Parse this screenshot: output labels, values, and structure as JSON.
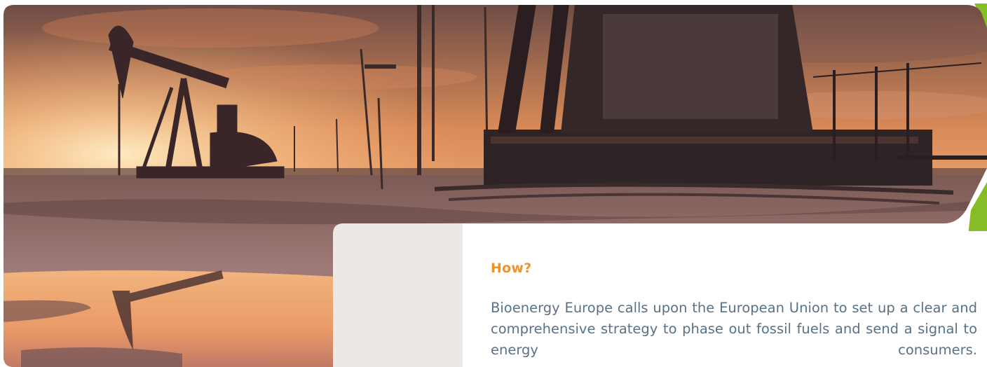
{
  "section": {
    "heading": "How?",
    "body": "Bioenergy Europe calls upon the European Union to set up a clear and comprehensive strategy to phase out fossil fuels and send a signal to energy consumers."
  },
  "colors": {
    "heading_accent": "#f0922b",
    "body_text": "#5a7186",
    "card_background": "#ece9e4",
    "brand_green": "#86bc25"
  },
  "photo": {
    "subject": "oil pumpjacks at sunset"
  }
}
